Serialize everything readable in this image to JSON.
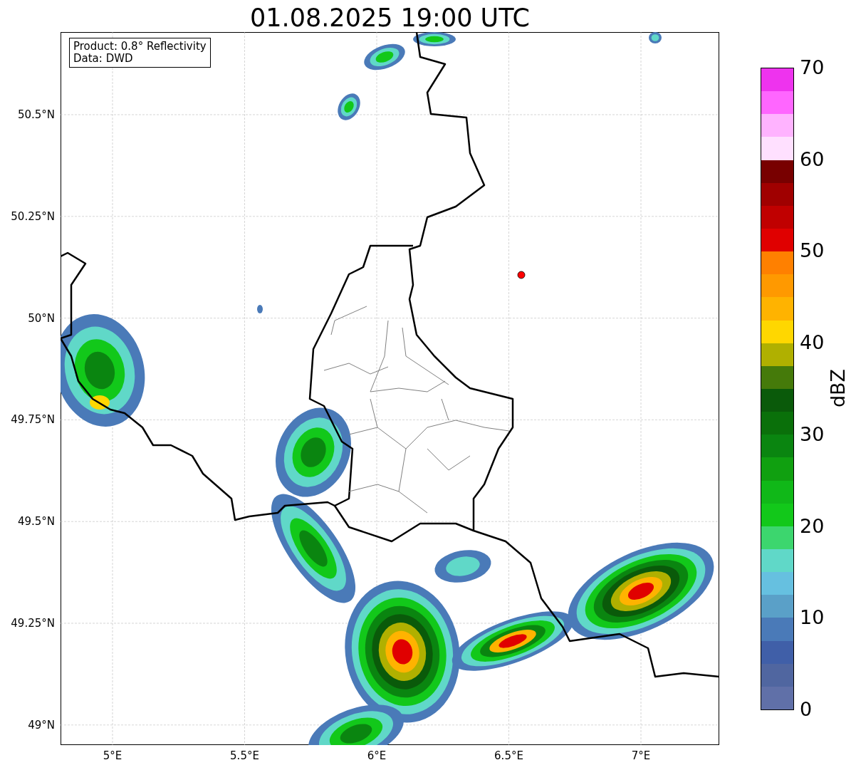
{
  "title": "01.08.2025 19:00 UTC",
  "legend": {
    "lines": [
      "Product: 0.8° Reflectivity",
      "Data: DWD"
    ]
  },
  "map": {
    "y_ticks": [
      "50.5°N",
      "50.25°N",
      "50°N",
      "49.75°N",
      "49.5°N",
      "49.25°N",
      "49°N"
    ],
    "x_ticks": [
      "5°E",
      "5.5°E",
      "6°E",
      "6.5°E",
      "7°E"
    ]
  },
  "colorbar": {
    "label": "dBZ",
    "ticks": [
      "70",
      "60",
      "50",
      "40",
      "30",
      "20",
      "10",
      "0"
    ],
    "bins": [
      {
        "color": "#ee33ee"
      },
      {
        "color": "#ff66ff"
      },
      {
        "color": "#ffb3ff"
      },
      {
        "color": "#ffe0ff"
      },
      {
        "color": "#780000"
      },
      {
        "color": "#a00000"
      },
      {
        "color": "#c00000"
      },
      {
        "color": "#e00000"
      },
      {
        "color": "#ff8000"
      },
      {
        "color": "#ff9900"
      },
      {
        "color": "#ffb300"
      },
      {
        "color": "#ffd700"
      },
      {
        "color": "#b0b000"
      },
      {
        "color": "#457a0a"
      },
      {
        "color": "#0a5a0a"
      },
      {
        "color": "#0a700a"
      },
      {
        "color": "#0a8510"
      },
      {
        "color": "#10a010"
      },
      {
        "color": "#10b818"
      },
      {
        "color": "#12c81a"
      },
      {
        "color": "#3cd66e"
      },
      {
        "color": "#60d8c8"
      },
      {
        "color": "#66c0e0"
      },
      {
        "color": "#5aa0c8"
      },
      {
        "color": "#4a7ab8"
      },
      {
        "color": "#405fa8"
      },
      {
        "color": "#5066a0"
      },
      {
        "color": "#6070a8"
      }
    ]
  }
}
